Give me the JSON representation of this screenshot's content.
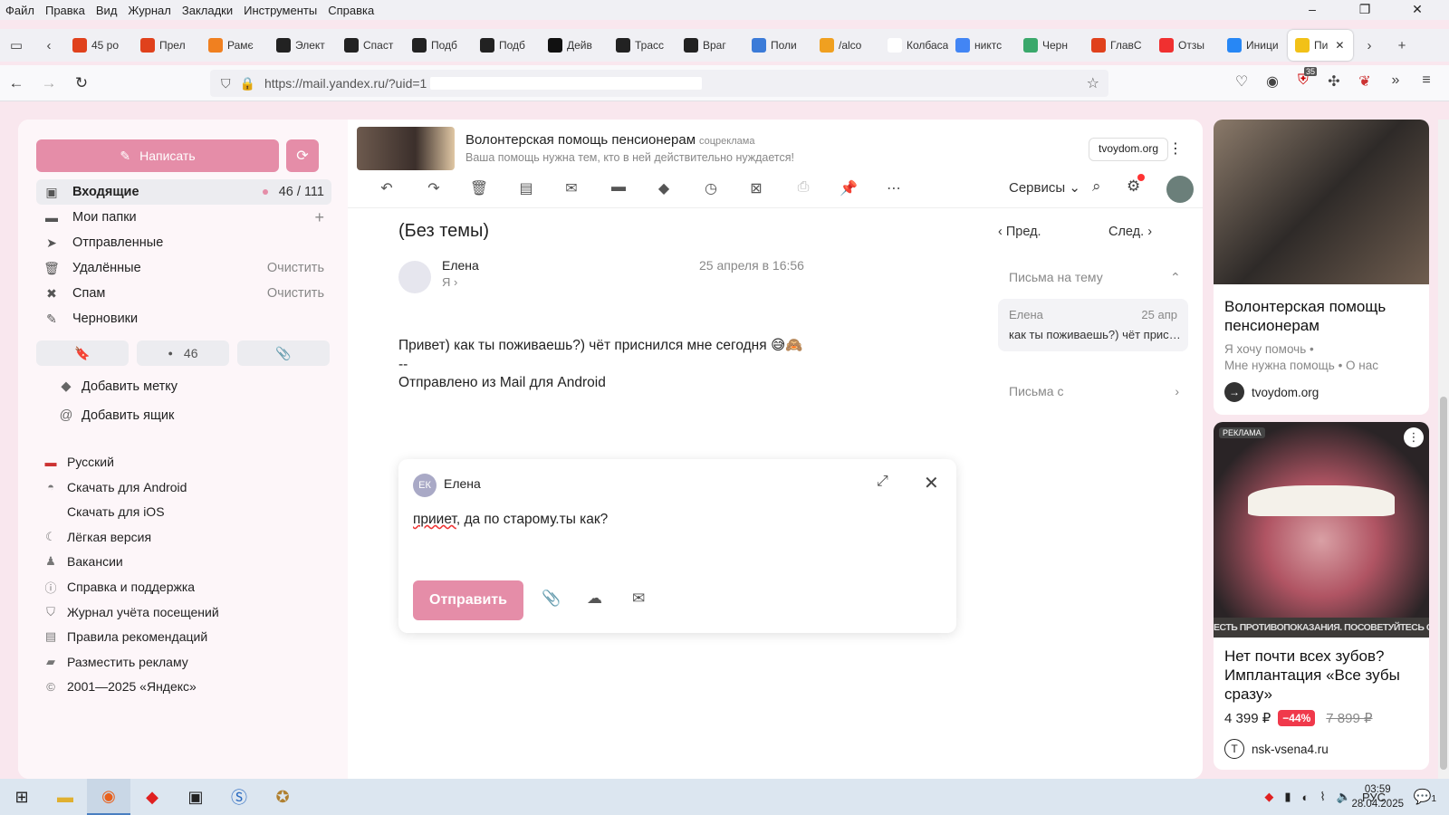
{
  "menubar": {
    "items": [
      "Файл",
      "Правка",
      "Вид",
      "Журнал",
      "Закладки",
      "Инструменты",
      "Справка"
    ],
    "window_controls": [
      "–",
      "❐",
      "✕"
    ]
  },
  "tabs": [
    {
      "label": "45 ро",
      "color": "#e0411c"
    },
    {
      "label": "Прел",
      "color": "#e0411c"
    },
    {
      "label": "Рамє",
      "color": "#f08020"
    },
    {
      "label": "Элект",
      "color": "#222222"
    },
    {
      "label": "Спаст",
      "color": "#222222"
    },
    {
      "label": "Подб",
      "color": "#222222"
    },
    {
      "label": "Подб",
      "color": "#222222"
    },
    {
      "label": "Дейв",
      "color": "#111111"
    },
    {
      "label": "Трасс",
      "color": "#222222"
    },
    {
      "label": "Враг",
      "color": "#222222"
    },
    {
      "label": "Поли",
      "color": "#3b7bd8"
    },
    {
      "label": "/alco",
      "color": "#f0a020"
    },
    {
      "label": "Колбаса",
      "color": "#ffffff"
    },
    {
      "label": "никтс",
      "color": "#4285f4"
    },
    {
      "label": "Черн",
      "color": "#3aa86b"
    },
    {
      "label": "ГлавС",
      "color": "#e0411c"
    },
    {
      "label": "Отзы",
      "color": "#f03030"
    },
    {
      "label": "Иници",
      "color": "#2787f5"
    },
    {
      "label": "Пи",
      "color": "#f2c118",
      "active": true
    }
  ],
  "url": {
    "text": "https://mail.yandex.ru/?uid=1"
  },
  "toolbar_ext_badge": "35",
  "sidebar": {
    "compose_label": "Написать",
    "folders": [
      {
        "label": "Входящие",
        "right": "46 / 111",
        "active": true,
        "icon": "inbox-icon",
        "glyph": "▣"
      },
      {
        "label": "Мои папки",
        "right": "+",
        "icon": "folder-icon",
        "glyph": "▬"
      },
      {
        "label": "Отправленные",
        "right": "",
        "icon": "send-icon",
        "glyph": "➤"
      },
      {
        "label": "Удалённые",
        "right": "Очистить",
        "icon": "trash-icon",
        "glyph": "🗑"
      },
      {
        "label": "Спам",
        "right": "Очистить",
        "icon": "spam-icon",
        "glyph": "✖"
      },
      {
        "label": "Черновики",
        "right": "",
        "icon": "drafts-icon",
        "glyph": "✎"
      }
    ],
    "chips": {
      "unread_count": "46"
    },
    "add_label": "Добавить метку",
    "add_box": "Добавить ящик",
    "links": [
      {
        "label": "Русский",
        "icon": "flag-ru-icon",
        "glyph": "▬"
      },
      {
        "label": "Скачать для Android",
        "icon": "android-icon",
        "glyph": "◓"
      },
      {
        "label": "Скачать для iOS",
        "icon": "apple-icon",
        "glyph": ""
      },
      {
        "label": "Лёгкая версия",
        "icon": "moon-icon",
        "glyph": "☾"
      },
      {
        "label": "Вакансии",
        "icon": "vacancy-icon",
        "glyph": "♟"
      },
      {
        "label": "Справка и поддержка",
        "icon": "help-icon",
        "glyph": "ⓘ"
      },
      {
        "label": "Журнал учёта посещений",
        "icon": "shield-icon",
        "glyph": "⛉"
      },
      {
        "label": "Правила рекомендаций",
        "icon": "rules-icon",
        "glyph": "▤"
      },
      {
        "label": "Разместить рекламу",
        "icon": "bag-icon",
        "glyph": "▰"
      },
      {
        "label": "2001—2025 «Яндекс»",
        "icon": "copyright-icon",
        "glyph": "©"
      }
    ]
  },
  "topad": {
    "title": "Волонтерская помощь пенсионерам",
    "tag": "соцреклама",
    "subtitle": "Ваша помощь нужна тем, кто в ней действительно нуждается!",
    "domain": "tvoydom.org"
  },
  "header": {
    "services": "Сервисы"
  },
  "message": {
    "subject": "(Без темы)",
    "prev": "Пред.",
    "next": "След.",
    "sender": "Елена",
    "date": "25 апреля в 16:56",
    "to": "Я",
    "body_line1": "Привет) как ты поживаешь?) чёт приснился мне сегодня 😅🙈",
    "body_line2": "--",
    "body_line3": "Отправлено из Mail для Android"
  },
  "thread": {
    "header": "Письма на тему",
    "card_name": "Елена",
    "card_date": "25 апр",
    "card_text": "как ты поживаешь?) чёт присниться",
    "letters_from": "Письма с"
  },
  "reply": {
    "initials": "ЕК",
    "to": "Елена",
    "text_misspelled": "прииет",
    "text_rest": ", да по старому.ты как?",
    "send_label": "Отправить"
  },
  "ad1": {
    "title": "Волонтерская помощь пенсионерам",
    "line1": "Я хочу помочь",
    "line2": "Мне нужна помощь",
    "line3": "О нас",
    "domain": "tvoydom.org"
  },
  "ad2": {
    "label": "РЕКЛАМА",
    "strip": "ЕСТЬ ПРОТИВОПОКАЗАНИЯ. ПОСОВЕТУЙТЕСЬ С ВРАЧОМ",
    "title": "Нет почти всех зубов? Имплантация «Все зубы сразу»",
    "price": "4 399 ₽",
    "discount": "−44%",
    "old_price": "7 899 ₽",
    "domain": "nsk-vsena4.ru"
  },
  "taskbar": {
    "lang": "РУС",
    "time": "03:59",
    "date": "28.04.2025",
    "notif_count": "1"
  }
}
